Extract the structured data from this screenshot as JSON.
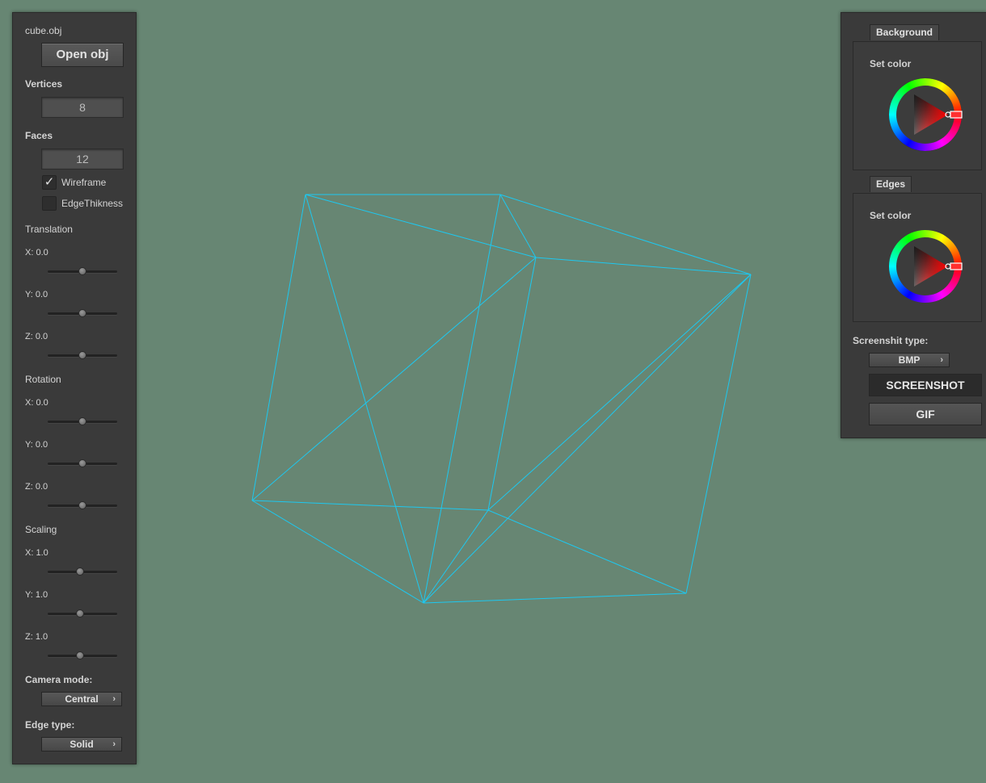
{
  "colors": {
    "background": "#678673",
    "edges": "#1dc8f0",
    "panel": "#3a3a3a"
  },
  "left_panel": {
    "file_name": "cube.obj",
    "open_button": "Open obj",
    "vertices_label": "Vertices",
    "vertices_value": "8",
    "faces_label": "Faces",
    "faces_value": "12",
    "wireframe_label": "Wireframe",
    "wireframe_checked": true,
    "wireframe_mark": "✓",
    "edge_thickness_label": "EdgeThikness",
    "edge_thickness_checked": false,
    "translation": {
      "title": "Translation",
      "x_label": "X: 0.0",
      "x_value": 0.5,
      "y_label": "Y: 0.0",
      "y_value": 0.5,
      "z_label": "Z: 0.0",
      "z_value": 0.5
    },
    "rotation": {
      "title": "Rotation",
      "x_label": "X: 0.0",
      "x_value": 0.5,
      "y_label": "Y: 0.0",
      "y_value": 0.5,
      "z_label": "Z: 0.0",
      "z_value": 0.5
    },
    "scaling": {
      "title": "Scaling",
      "x_label": "X: 1.0",
      "x_value": 0.47,
      "y_label": "Y: 1.0",
      "y_value": 0.47,
      "z_label": "Z: 1.0",
      "z_value": 0.47
    },
    "camera_mode_label": "Camera mode:",
    "camera_mode_value": "Central",
    "edge_type_label": "Edge type:",
    "edge_type_value": "Solid",
    "chevron_icon": "›"
  },
  "right_panel": {
    "background_tab": "Background",
    "background_set_color": "Set color",
    "edges_tab": "Edges",
    "edges_set_color": "Set color",
    "screenshot_type_label": "Screenshit type:",
    "screenshot_type_value": "BMP",
    "screenshot_button": "SCREENSHOT",
    "gif_button": "GIF",
    "chevron_icon": "›"
  }
}
